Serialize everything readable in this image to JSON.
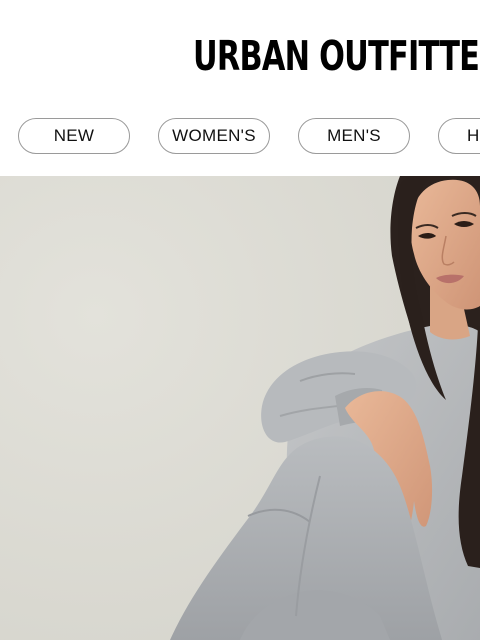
{
  "header": {
    "logo_text": "URBAN OUTFITTERS"
  },
  "nav": {
    "items": [
      {
        "label": "NEW"
      },
      {
        "label": "WOMEN'S"
      },
      {
        "label": "MEN'S"
      },
      {
        "label": "H"
      }
    ]
  },
  "hero": {
    "image_description_icon": "hero-photo"
  },
  "colors": {
    "background": "#ffffff",
    "text": "#000000",
    "pill_border": "#9a9a9a",
    "hero_backdrop": "#dedcd5"
  }
}
